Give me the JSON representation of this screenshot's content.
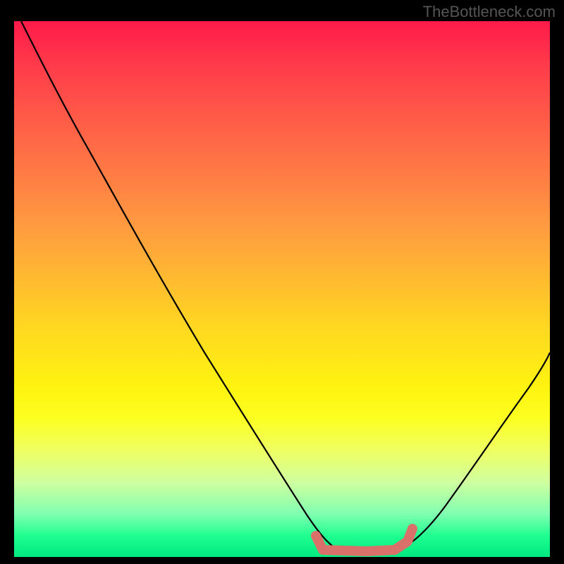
{
  "watermark": "TheBottleneck.com",
  "chart_data": {
    "type": "line",
    "title": "",
    "xlabel": "",
    "ylabel": "",
    "xlim": [
      0,
      100
    ],
    "ylim": [
      0,
      100
    ],
    "x": [
      0,
      5,
      10,
      15,
      20,
      25,
      30,
      35,
      40,
      45,
      50,
      55,
      58,
      60,
      63,
      66,
      70,
      74,
      78,
      82,
      86,
      90,
      94,
      98,
      100
    ],
    "values": [
      100,
      96,
      90,
      83,
      76,
      69,
      62,
      54,
      46,
      38,
      30,
      20,
      12,
      6,
      2,
      0,
      0,
      0,
      2,
      6,
      12,
      20,
      28,
      36,
      40
    ],
    "optimal_range": {
      "x_start": 58,
      "x_end": 78,
      "y": 0
    },
    "annotations": [],
    "colors": {
      "curve": "#000000",
      "marker": "#d9706a",
      "gradient_top": "#ff1a4a",
      "gradient_bottom": "#00e880"
    }
  }
}
